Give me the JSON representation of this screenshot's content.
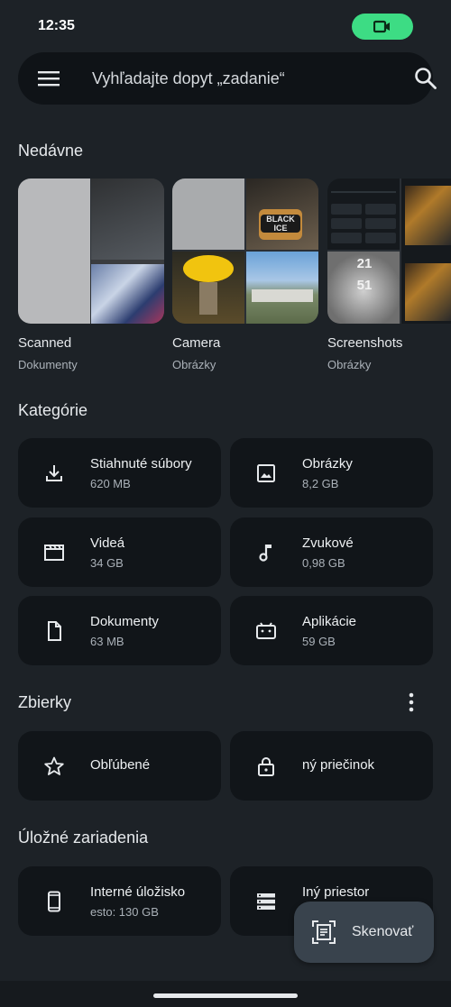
{
  "status": {
    "time": "12:35"
  },
  "search": {
    "placeholder": "Vyhľadajte dopyt „zadanie“"
  },
  "recent": {
    "title": "Nedávne",
    "items": [
      {
        "name": "Scanned",
        "sub": "Dokumenty"
      },
      {
        "name": "Camera",
        "sub": "Obrázky"
      },
      {
        "name": "Screenshots",
        "sub": "Obrázky"
      }
    ],
    "jar_text": "BLACK ICE",
    "clock_text": [
      "21",
      "51"
    ]
  },
  "categories": {
    "title": "Kategórie",
    "items": [
      {
        "label": "Stiahnuté súbory",
        "size": "620 MB",
        "icon": "download-icon"
      },
      {
        "label": "Obrázky",
        "size": "8,2 GB",
        "icon": "image-icon"
      },
      {
        "label": "Videá",
        "size": "34 GB",
        "icon": "video-icon"
      },
      {
        "label": "Zvukové",
        "size": "0,98 GB",
        "icon": "music-note-icon"
      },
      {
        "label": "Dokumenty",
        "size": "63 MB",
        "icon": "document-icon"
      },
      {
        "label": "Aplikácie",
        "size": "59 GB",
        "icon": "android-icon"
      }
    ]
  },
  "collections": {
    "title": "Zbierky",
    "items": [
      {
        "label": "Obľúbené",
        "icon": "star-icon"
      },
      {
        "label": "ný priečinok",
        "icon": "lock-icon"
      }
    ]
  },
  "storage": {
    "title": "Úložné zariadenia",
    "items": [
      {
        "label": "Interné úložisko",
        "sub": "esto: 130 GB",
        "icon": "phone-icon"
      },
      {
        "label": "Iný priestor",
        "icon": "storage-icon"
      }
    ]
  },
  "fab": {
    "label": "Skenovať",
    "icon": "scan-document-icon"
  }
}
